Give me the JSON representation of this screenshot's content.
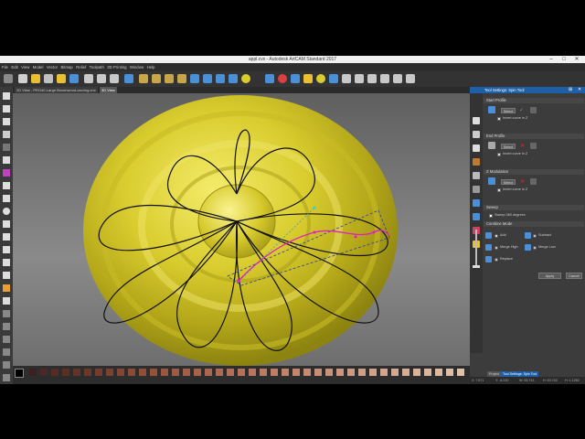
{
  "window": {
    "title": "appl.cvx - Autodesk ArtCAM Standard 2017",
    "min": "–",
    "max": "□",
    "close": "✕"
  },
  "menu": [
    "File",
    "Edit",
    "View",
    "Model",
    "Vector",
    "Bitmap",
    "Relief",
    "Toolpath",
    "3D Printing",
    "Window",
    "Help"
  ],
  "tabs": [
    "2D View - PRO40-Large Brownwood-carving.crw",
    "3D View"
  ],
  "panel": {
    "title": "Tool Settings: Spin Tool",
    "start_profile": {
      "heading": "Start Profile",
      "select": "Select",
      "invert": "Invert curve in Z"
    },
    "end_profile": {
      "heading": "End Profile",
      "select": "Select",
      "invert": "Invert curve in Z"
    },
    "z_modulation": {
      "heading": "Z Modulation",
      "select": "Select",
      "invert": "Invert curve in Z"
    },
    "sweep": {
      "heading": "Sweep",
      "option": "Sweep 360 degrees"
    },
    "combine": {
      "heading": "Combine Mode",
      "add": "Add",
      "subtract": "Subtract",
      "merge_high": "Merge High",
      "merge_low": "Merge Low",
      "replace": "Replace"
    },
    "apply": "Apply",
    "cancel": "Cancel",
    "bottom_tabs": [
      "Project",
      "Tool Settings: Spin Tool"
    ]
  },
  "status": {
    "x": "X: 7.671",
    "y": "Y: -6.220",
    "w": "W: 53.743",
    "h": "H: 53.743",
    "h2": "H: 1.1260"
  },
  "colors": {
    "accent": "#1f5fa5",
    "relief": "#d9cc2e",
    "curve": "#e020c0"
  }
}
